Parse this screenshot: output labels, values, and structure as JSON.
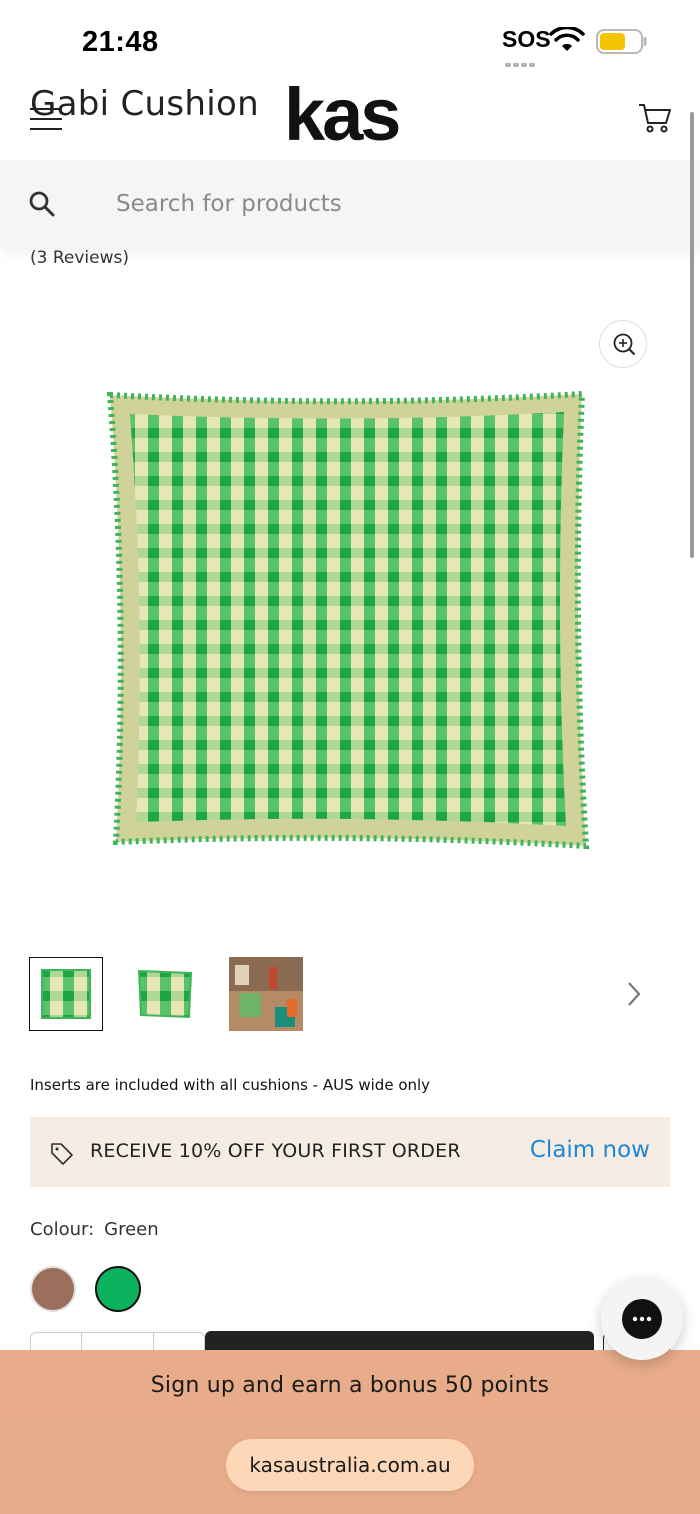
{
  "status_bar": {
    "time": "21:48",
    "sos": "SOS"
  },
  "header": {
    "page_name": "Gabi Cushion",
    "logo": "kas"
  },
  "search": {
    "placeholder": "Search for products"
  },
  "product": {
    "reviews": "(3 Reviews)",
    "inserts_note": "Inserts are included with all cushions - AUS wide only",
    "colour_label": "Colour:",
    "colour_value": "Green",
    "swatches": [
      {
        "name": "brown",
        "color": "#9b6f5c"
      },
      {
        "name": "green",
        "color": "#0cb35e"
      }
    ]
  },
  "promo": {
    "text": "RECEIVE 10% OFF YOUR FIRST ORDER",
    "link": "Claim now"
  },
  "signup_banner": {
    "text": "Sign up and earn a bonus 50 points"
  },
  "browser": {
    "url": "kasaustralia.com.au"
  },
  "colors": {
    "gingham_green": "#2db84a",
    "gingham_cream": "#e8e7b8",
    "promo_bg": "#f5ede3",
    "link_blue": "#1f86d6",
    "banner_peach": "#e8ac8a"
  },
  "icons": [
    "menu-icon",
    "cart-icon",
    "search-icon",
    "zoom-in-icon",
    "chevron-right-icon",
    "tag-icon",
    "chat-icon",
    "wifi-icon",
    "battery-icon"
  ]
}
